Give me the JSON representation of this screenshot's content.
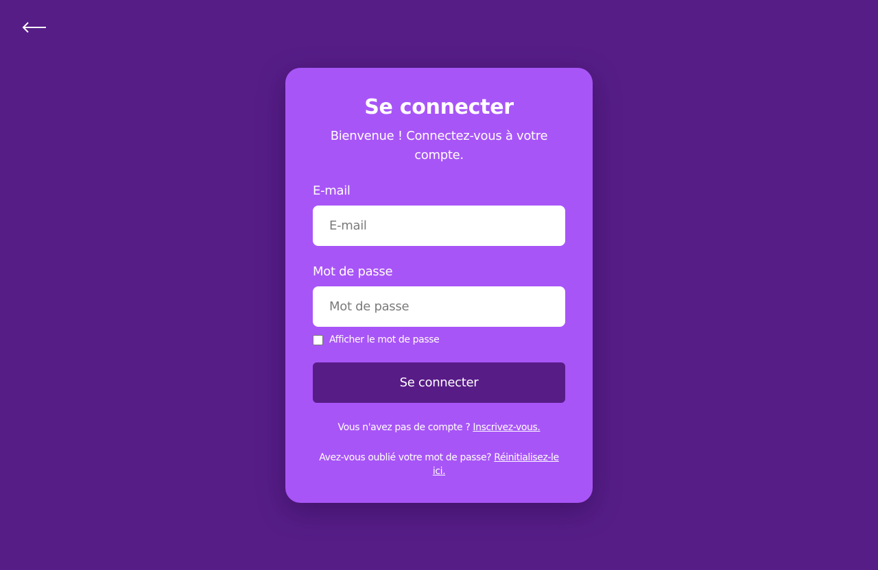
{
  "back": {
    "icon": "arrow-left-icon"
  },
  "card": {
    "title": "Se connecter",
    "subtitle": "Bienvenue ! Connectez-vous à votre compte."
  },
  "form": {
    "email_label": "E-mail",
    "email_placeholder": "E-mail",
    "email_value": "",
    "password_label": "Mot de passe",
    "password_placeholder": "Mot de passe",
    "password_value": "",
    "show_password_label": "Afficher le mot de passe",
    "show_password_checked": false,
    "submit_label": "Se connecter"
  },
  "signup": {
    "text": "Vous n'avez pas de compte ? ",
    "link": "Inscrivez-vous."
  },
  "reset": {
    "text": "Avez-vous oublié votre mot de passe? ",
    "link": "Réinitialisez-le ici."
  },
  "colors": {
    "background": "#561d87",
    "card": "#a855f7",
    "button": "#581c87",
    "text": "#ffffff"
  }
}
